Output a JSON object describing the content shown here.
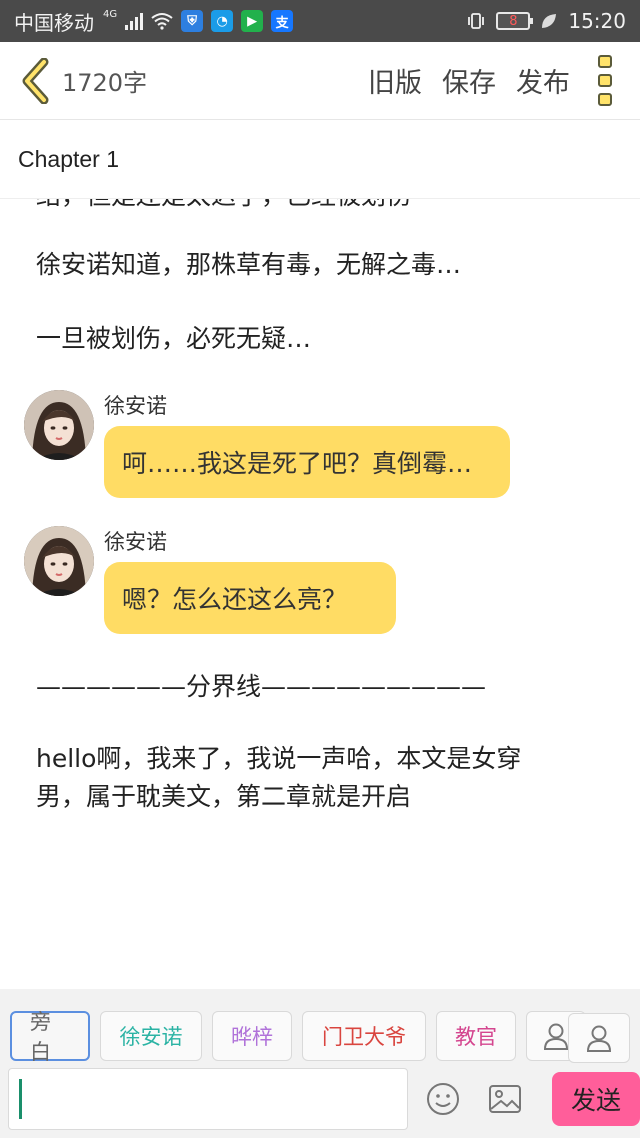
{
  "status_bar": {
    "carrier": "中国移动",
    "network": "4G",
    "battery": "8",
    "time": "15:20"
  },
  "header": {
    "word_count": "1720字",
    "actions": [
      "旧版",
      "保存",
      "发布"
    ]
  },
  "chapter_title": "Chapter 1",
  "content": {
    "cut_line": "结，但是还是太迟了，已经被划伤",
    "paragraph_1": "徐安诺知道，那株草有毒，无解之毒…",
    "paragraph_2": "一旦被划伤，必死无疑…",
    "messages": [
      {
        "speaker": "徐安诺",
        "text": "呵……我这是死了吧？真倒霉…"
      },
      {
        "speaker": "徐安诺",
        "text": "嗯？怎么还这么亮？"
      }
    ],
    "divider": "——————分界线—————————",
    "closing_line_1": "hello啊，我来了，我说一声哈，本文是女穿",
    "closing_line_2": "男，属于耽美文，第二章就是开启"
  },
  "roles": [
    {
      "label": "旁白",
      "color": "#666666",
      "active": true
    },
    {
      "label": "徐安诺",
      "color": "#2bb3a4",
      "active": false
    },
    {
      "label": "晔梓",
      "color": "#b072d9",
      "active": false
    },
    {
      "label": "门卫大爷",
      "color": "#d9453f",
      "active": false
    },
    {
      "label": "教官",
      "color": "#d4468f",
      "active": false
    }
  ],
  "input": {
    "send_label": "发送"
  },
  "icons": {
    "back": "chevron-left-icon",
    "menu": "more-icon",
    "emoji": "emoji-icon",
    "image": "image-icon",
    "add_role": "person-icon"
  },
  "colors": {
    "accent_yellow": "#ffdc64",
    "send_pink": "#ff5e9a"
  }
}
